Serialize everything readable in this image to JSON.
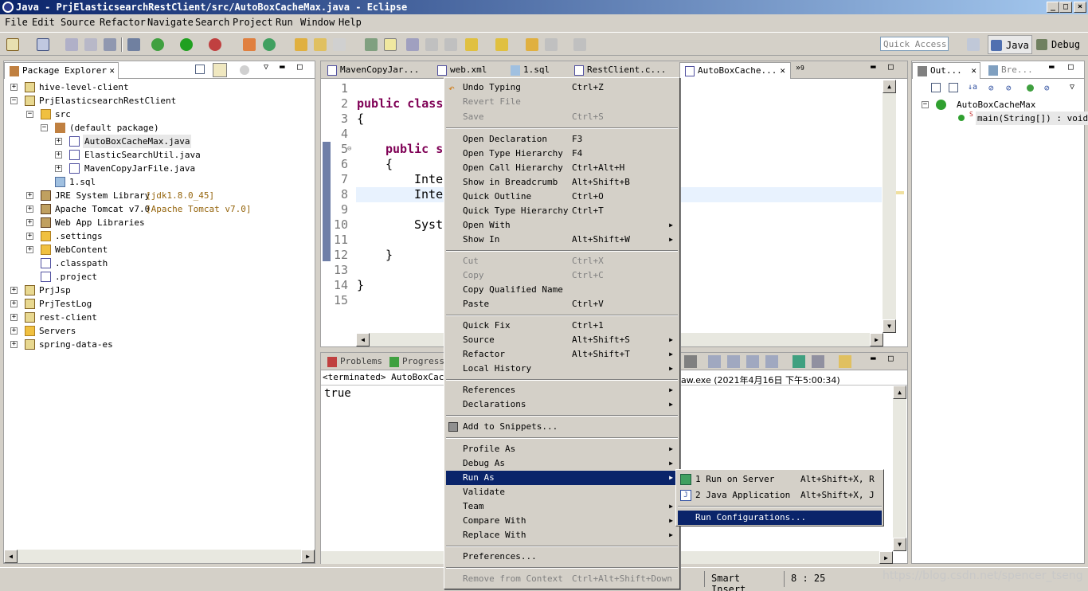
{
  "window": {
    "title": "Java - PrjElasticsearchRestClient/src/AutoBoxCacheMax.java - Eclipse"
  },
  "menubar": [
    "File",
    "Edit",
    "Source",
    "Refactor",
    "Navigate",
    "Search",
    "Project",
    "Run",
    "Window",
    "Help"
  ],
  "toolbar": {
    "quick_access_placeholder": "Quick Access",
    "perspectives": [
      "Java",
      "Debug"
    ]
  },
  "package_explorer": {
    "tab_label": "Package Explorer",
    "nodes": {
      "n0": "hive-level-client",
      "n1": "PrjElasticsearchRestClient",
      "n2": "src",
      "n3": "(default package)",
      "n4": "AutoBoxCacheMax.java",
      "n5": "ElasticSearchUtil.java",
      "n6": "MavenCopyJarFile.java",
      "n7": "1.sql",
      "n8": "JRE System Library",
      "n8b": "[jdk1.8.0_45]",
      "n9": "Apache Tomcat v7.0",
      "n9b": "[Apache Tomcat v7.0]",
      "n10": "Web App Libraries",
      "n11": ".settings",
      "n12": "WebContent",
      "n13": ".classpath",
      "n14": ".project",
      "n15": "PrjJsp",
      "n16": "PrjTestLog",
      "n17": "rest-client",
      "n18": "Servers",
      "n19": "spring-data-es"
    }
  },
  "editor": {
    "tabs": [
      "MavenCopyJar...",
      "web.xml",
      "1.sql",
      "RestClient.c...",
      "AutoBoxCache..."
    ],
    "overflow_count": "9",
    "line_numbers": [
      "1",
      "2",
      "3",
      "4",
      "5",
      "6",
      "7",
      "8",
      "9",
      "10",
      "11",
      "12",
      "13",
      "14",
      "15"
    ],
    "code": {
      "l2a": "public class",
      "l3": "{",
      "l5a": "public s",
      "l6": "{",
      "l7": "Inte",
      "l8": "Inte",
      "l10": "Syst",
      "l12": "}",
      "l14": "}"
    }
  },
  "outline": {
    "tab_label": "Out...",
    "tab2_label": "Bre...",
    "class_name": "AutoBoxCacheMax",
    "method": "main(String[]) : void"
  },
  "console": {
    "tabs": [
      "Problems",
      "Progress"
    ],
    "status_left": "<terminated> AutoBoxCache",
    "status_right": "aw.exe (2021年4月16日 下午5:00:34)",
    "output": "true"
  },
  "context_menu": {
    "items": {
      "undo": {
        "label": "Undo Typing",
        "acc": "Ctrl+Z"
      },
      "revert": {
        "label": "Revert File",
        "acc": ""
      },
      "save": {
        "label": "Save",
        "acc": "Ctrl+S"
      },
      "open_decl": {
        "label": "Open Declaration",
        "acc": "F3"
      },
      "open_type_h": {
        "label": "Open Type Hierarchy",
        "acc": "F4"
      },
      "open_call_h": {
        "label": "Open Call Hierarchy",
        "acc": "Ctrl+Alt+H"
      },
      "breadcrumb": {
        "label": "Show in Breadcrumb",
        "acc": "Alt+Shift+B"
      },
      "quick_outline": {
        "label": "Quick Outline",
        "acc": "Ctrl+O"
      },
      "quick_type_h": {
        "label": "Quick Type Hierarchy",
        "acc": "Ctrl+T"
      },
      "open_with": {
        "label": "Open With",
        "acc": ""
      },
      "show_in": {
        "label": "Show In",
        "acc": "Alt+Shift+W"
      },
      "cut": {
        "label": "Cut",
        "acc": "Ctrl+X"
      },
      "copy": {
        "label": "Copy",
        "acc": "Ctrl+C"
      },
      "copy_qn": {
        "label": "Copy Qualified Name",
        "acc": ""
      },
      "paste": {
        "label": "Paste",
        "acc": "Ctrl+V"
      },
      "quick_fix": {
        "label": "Quick Fix",
        "acc": "Ctrl+1"
      },
      "source": {
        "label": "Source",
        "acc": "Alt+Shift+S"
      },
      "refactor": {
        "label": "Refactor",
        "acc": "Alt+Shift+T"
      },
      "local_history": {
        "label": "Local History",
        "acc": ""
      },
      "references": {
        "label": "References",
        "acc": ""
      },
      "declarations": {
        "label": "Declarations",
        "acc": ""
      },
      "add_snippets": {
        "label": "Add to Snippets...",
        "acc": ""
      },
      "profile_as": {
        "label": "Profile As",
        "acc": ""
      },
      "debug_as": {
        "label": "Debug As",
        "acc": ""
      },
      "run_as": {
        "label": "Run As",
        "acc": ""
      },
      "validate": {
        "label": "Validate",
        "acc": ""
      },
      "team": {
        "label": "Team",
        "acc": ""
      },
      "compare_with": {
        "label": "Compare With",
        "acc": ""
      },
      "replace_with": {
        "label": "Replace With",
        "acc": ""
      },
      "preferences": {
        "label": "Preferences...",
        "acc": ""
      },
      "remove_ctx": {
        "label": "Remove from Context",
        "acc": "Ctrl+Alt+Shift+Down"
      }
    }
  },
  "run_as_submenu": {
    "run_server": {
      "label": "1 Run on Server",
      "acc": "Alt+Shift+X, R"
    },
    "java_app": {
      "label": "2 Java Application",
      "acc": "Alt+Shift+X, J"
    },
    "run_configs": {
      "label": "Run Configurations..."
    }
  },
  "statusbar": {
    "mode": "Smart Insert",
    "position": "8 : 25",
    "watermark": "https://blog.csdn.net/spencer_tseng"
  }
}
